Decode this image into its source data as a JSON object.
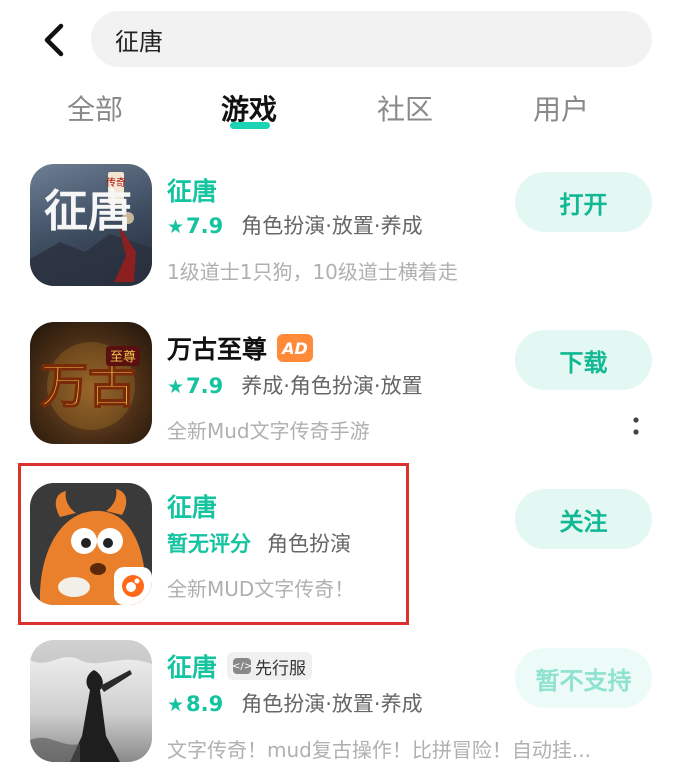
{
  "search": {
    "value": "征唐"
  },
  "tabs": [
    {
      "label": "全部"
    },
    {
      "label": "游戏"
    },
    {
      "label": "社区"
    },
    {
      "label": "用户"
    }
  ],
  "results": [
    {
      "name": "征唐",
      "rating": "7.9",
      "tags": "角色扮演·放置·养成",
      "desc": "1级道士1只狗，10级道士横着走",
      "button": "打开",
      "icon_title": "征唐",
      "icon_sub": "传奇"
    },
    {
      "name": "万古至尊",
      "badge": "AD",
      "rating": "7.9",
      "tags": "养成·角色扮演·放置",
      "desc": "全新Mud文字传奇手游",
      "button": "下载",
      "icon_title": "万古",
      "icon_sub": "至尊"
    },
    {
      "name": "征唐",
      "rating_text": "暂无评分",
      "tags": "角色扮演",
      "desc": "全新MUD文字传奇！",
      "button": "关注"
    },
    {
      "name": "征唐",
      "badge": "先行服",
      "badge_code": "</>",
      "rating": "8.9",
      "tags": "角色扮演·放置·养成",
      "desc": "文字传奇！mud复古操作！比拼冒险！自动挂...",
      "button": "暂不支持"
    }
  ],
  "colors": {
    "accent": "#14c3a0",
    "highlight": "#d8322b",
    "ad": "#ff8a3a"
  }
}
